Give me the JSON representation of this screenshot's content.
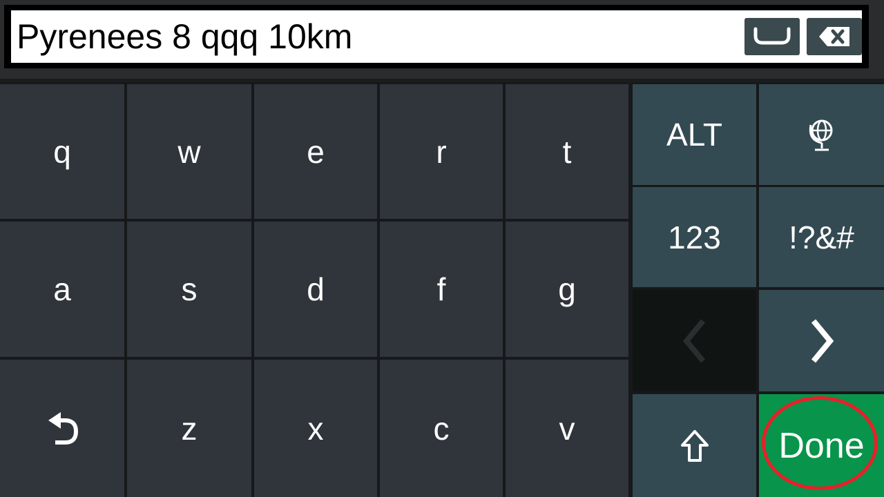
{
  "input": {
    "value": "Pyrenees 8 qqq 10km",
    "space_button": "space-icon",
    "backspace_button": "backspace-icon"
  },
  "keys": {
    "row1": [
      "q",
      "w",
      "e",
      "r",
      "t"
    ],
    "row2": [
      "a",
      "s",
      "d",
      "f",
      "g"
    ],
    "row3": [
      "z",
      "x",
      "c",
      "v"
    ],
    "undo_icon": "undo-icon",
    "alt": "ALT",
    "globe_icon": "globe-icon",
    "num": "123",
    "symbols": "!?&#",
    "left_icon": "chevron-left-icon",
    "right_icon": "chevron-right-icon",
    "shift_icon": "shift-icon",
    "done": "Done"
  },
  "colors": {
    "letter_key": "#30353c",
    "function_key": "#344a52",
    "done_key": "#08944a",
    "highlight_ring": "#e8202a"
  }
}
